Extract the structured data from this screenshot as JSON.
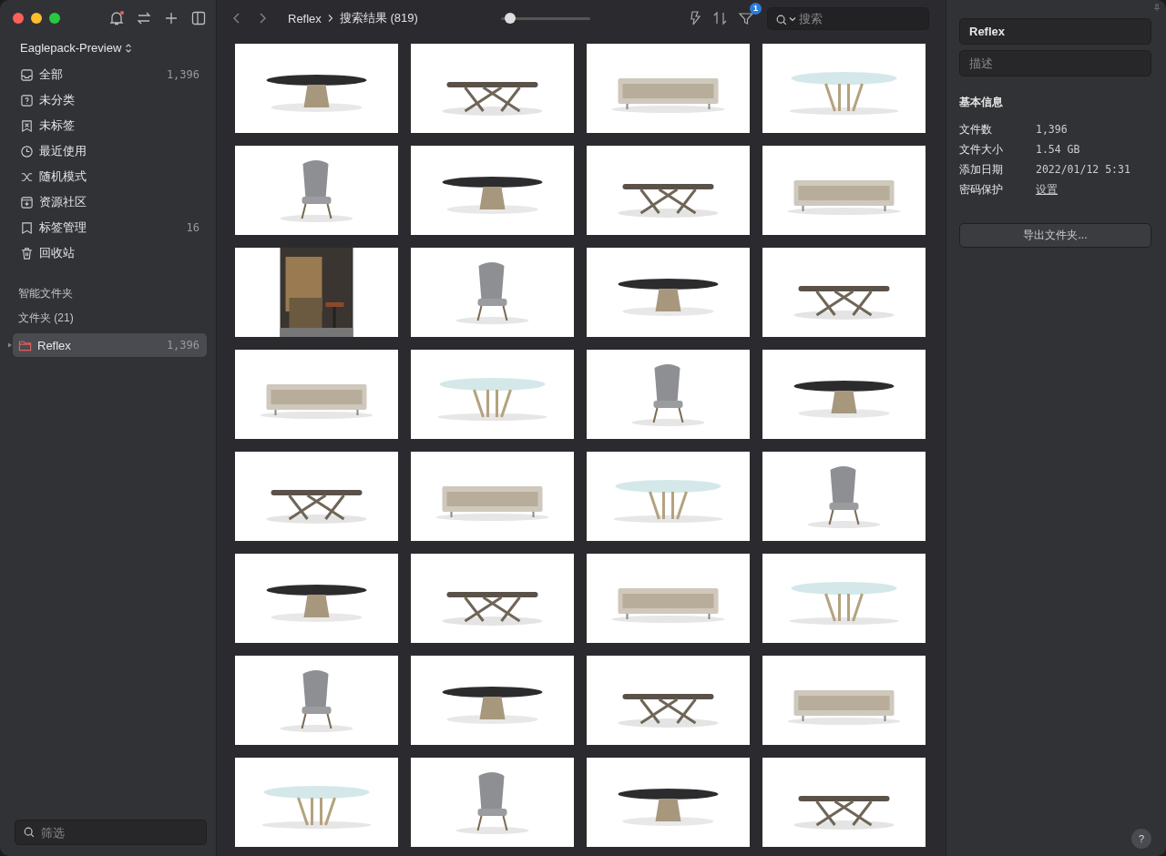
{
  "library": {
    "name": "Eaglepack-Preview"
  },
  "nav_items": [
    {
      "label": "全部",
      "count": "1,396"
    },
    {
      "label": "未分类"
    },
    {
      "label": "未标签"
    },
    {
      "label": "最近使用"
    },
    {
      "label": "随机模式"
    },
    {
      "label": "资源社区"
    },
    {
      "label": "标签管理",
      "count": "16"
    },
    {
      "label": "回收站"
    }
  ],
  "smart_folders": {
    "heading": "智能文件夹"
  },
  "folders": {
    "heading": "文件夹 (21)",
    "items": [
      {
        "name": "Reflex",
        "count": "1,396",
        "selected": true,
        "expanded": false
      }
    ]
  },
  "filter_field": {
    "placeholder": "筛选"
  },
  "toolbar": {
    "breadcrumb": [
      "Reflex",
      "搜索结果 (819)"
    ],
    "zoom_slider": {
      "level": 0.1
    },
    "filter_badge": "1",
    "search": {
      "placeholder": "搜索"
    }
  },
  "inspector": {
    "name_value": "Reflex",
    "description": {
      "placeholder": "描述"
    },
    "section_title": "基本信息",
    "properties": [
      {
        "label": "文件数",
        "value": "1,396",
        "kind": "text"
      },
      {
        "label": "文件大小",
        "value": "1.54 GB",
        "kind": "text"
      },
      {
        "label": "添加日期",
        "value": "2022/01/12 5:31",
        "kind": "text"
      },
      {
        "label": "密码保护",
        "value": "设置",
        "kind": "link"
      }
    ],
    "export_button": "导出文件夹...",
    "help_button": "?"
  }
}
